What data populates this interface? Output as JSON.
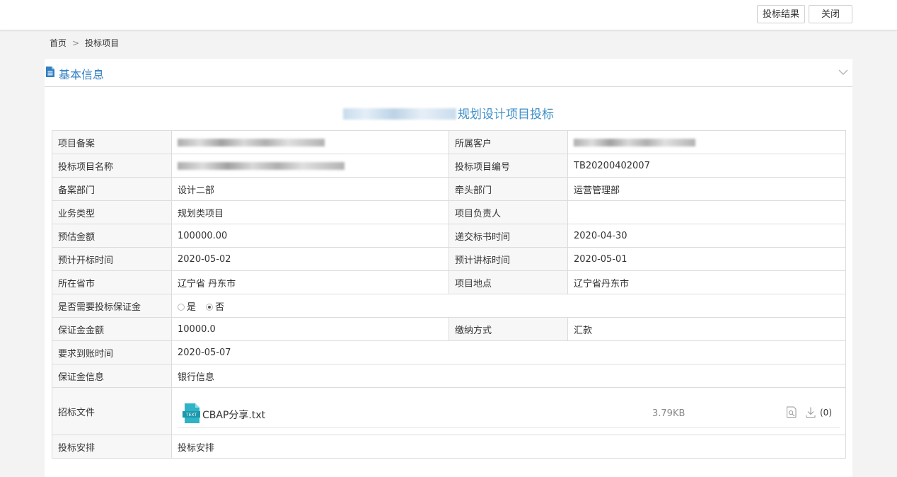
{
  "topbar": {
    "result_label": "投标结果",
    "close_label": "关闭"
  },
  "breadcrumb": {
    "home": "首页",
    "sep": ">",
    "current": "投标项目"
  },
  "section": {
    "title": "基本信息"
  },
  "project": {
    "title_suffix": "规划设计项目投标"
  },
  "rows": {
    "r1": {
      "l1": "项目备案",
      "l2": "所属客户"
    },
    "r2": {
      "l1": "投标项目名称",
      "l2": "投标项目编号",
      "v2": "TB20200402007"
    },
    "r3": {
      "l1": "备案部门",
      "v1": "设计二部",
      "l2": "牵头部门",
      "v2": "运营管理部"
    },
    "r4": {
      "l1": "业务类型",
      "v1": "规划类项目",
      "l2": "项目负责人",
      "v2": ""
    },
    "r5": {
      "l1": "预估金额",
      "v1": "100000.00",
      "l2": "递交标书时间",
      "v2": "2020-04-30"
    },
    "r6": {
      "l1": "预计开标时间",
      "v1": "2020-05-02",
      "l2": "预计讲标时间",
      "v2": "2020-05-01"
    },
    "r7": {
      "l1": "所在省市",
      "v1": "辽宁省 丹东市",
      "l2": "项目地点",
      "v2": "辽宁省丹东市"
    },
    "r8": {
      "l1": "是否需要投标保证金",
      "opt_yes": "是",
      "opt_no": "否",
      "selected": "否"
    },
    "r9": {
      "l1": "保证金金额",
      "v1": "10000.0",
      "l2": "缴纳方式",
      "v2": "汇款"
    },
    "r10": {
      "l1": "要求到账时间",
      "v1": "2020-05-07"
    },
    "r11": {
      "l1": "保证金信息",
      "v1": "银行信息"
    },
    "r12": {
      "l1": "招标文件"
    },
    "r13": {
      "l1": "投标安排",
      "v1": "投标安排"
    }
  },
  "file": {
    "badge": "TEXT",
    "name": "CBAP分享.txt",
    "size": "3.79KB",
    "downloads": "(0)"
  },
  "colors": {
    "accent": "#2f7fc2",
    "title": "#3d8fc9",
    "file_icon": "#2fb3c6"
  },
  "icons": [
    "document-icon",
    "chevron-down-icon",
    "file-text-icon",
    "preview-icon",
    "download-icon"
  ]
}
